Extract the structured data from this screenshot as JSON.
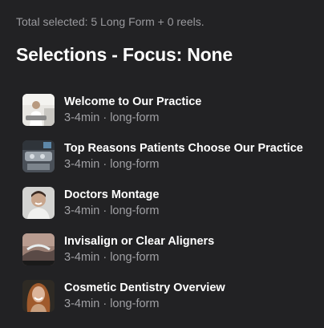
{
  "summary": "Total selected: 5 Long Form + 0 reels.",
  "heading": "Selections - Focus: None",
  "items": [
    {
      "title": "Welcome to Our Practice",
      "subtitle": "3-4min · long-form",
      "icon": "practice-thumbnail"
    },
    {
      "title": "Top Reasons Patients Choose Our Practice",
      "subtitle": "3-4min · long-form",
      "icon": "dental-equipment-thumbnail"
    },
    {
      "title": "Doctors Montage",
      "subtitle": "3-4min · long-form",
      "icon": "doctor-portrait-thumbnail"
    },
    {
      "title": "Invisalign or Clear Aligners",
      "subtitle": "3-4min · long-form",
      "icon": "aligners-thumbnail"
    },
    {
      "title": "Cosmetic Dentistry Overview",
      "subtitle": "3-4min · long-form",
      "icon": "smiling-woman-thumbnail"
    }
  ]
}
